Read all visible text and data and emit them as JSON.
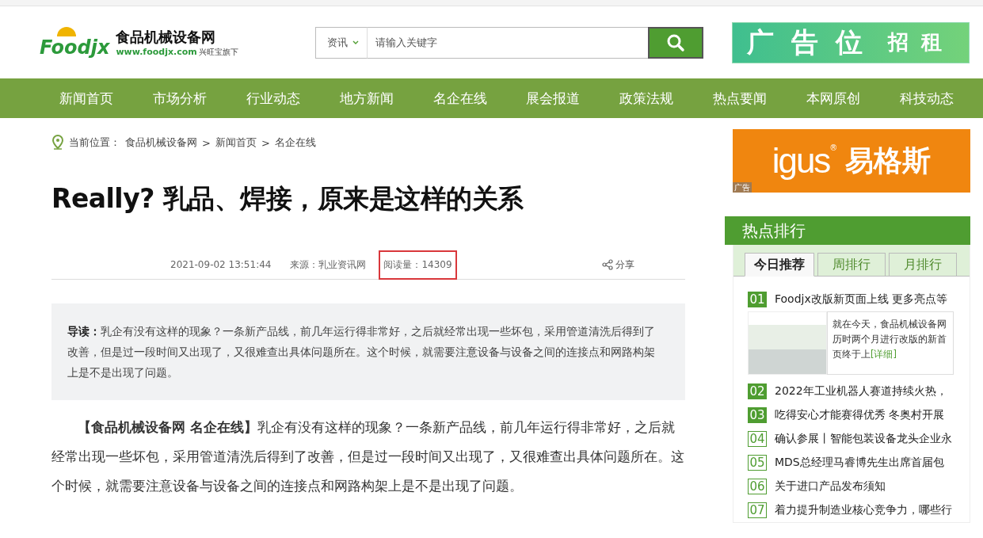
{
  "header": {
    "logo": {
      "mark": "Foodjx",
      "name": "食品机械设备网",
      "url": "www.foodjx.com",
      "owner": "兴旺宝旗下"
    },
    "search": {
      "category": "资讯",
      "placeholder": "请输入关键字"
    },
    "ad": {
      "main": [
        "广",
        "告",
        "位"
      ],
      "sub": [
        "招",
        "租"
      ]
    }
  },
  "nav": [
    {
      "label": "新闻首页"
    },
    {
      "label": "市场分析"
    },
    {
      "label": "行业动态"
    },
    {
      "label": "地方新闻"
    },
    {
      "label": "名企在线"
    },
    {
      "label": "展会报道"
    },
    {
      "label": "政策法规"
    },
    {
      "label": "热点要闻"
    },
    {
      "label": "本网原创"
    },
    {
      "label": "科技动态"
    }
  ],
  "breadcrumb": {
    "prefix": "当前位置：",
    "items": [
      "食品机械设备网",
      "新闻首页",
      "名企在线"
    ],
    "separator": ">"
  },
  "article": {
    "title": "Really? 乳品、焊接，原来是这样的关系",
    "date": "2021-09-02 13:51:44",
    "source": "来源：乳业资讯网",
    "views": "阅读量：14309",
    "views_highlighted": true,
    "share": "分享",
    "intro": "**导读：**乳企有没有这样的现象？一条新产品线，前几年运行得非常好，之后就经常出现一些坏包，采用管道清洗后得到了改善，但是过一段时间又出现了，又很难查出具体问题所在。这个时候，就需要注意设备与设备之间的连接点和网路构架上是不是出现了问题。",
    "body": "**【食品机械设备网 名企在线】**乳企有没有这样的现象？一条新产品线，前几年运行得非常好，之后就经常出现一些坏包，采用管道清洗后得到了改善，但是过一段时间又出现了，又很难查出具体问题所在。这个时候，就需要注意设备与设备之间的连接点和网路构架上是不是出现了问题。"
  },
  "sidebar": {
    "ad": {
      "brand": "igus",
      "mark": "®",
      "name": "易格斯",
      "tag": "广告"
    },
    "ranking": {
      "title": "热点排行",
      "tabs": [
        {
          "label": "今日推荐",
          "selected": true
        },
        {
          "label": "周排行",
          "selected": false
        },
        {
          "label": "月排行",
          "selected": false
        }
      ],
      "items": [
        {
          "rank": "01",
          "kind": "top",
          "title": "Foodjx改版新页面上线 更多亮点等",
          "preview": {
            "text": "就在今天，食品机械设备网历时两个月进行改版的新首页终于上",
            "link": "[详细]"
          }
        },
        {
          "rank": "02",
          "kind": "top",
          "title": "2022年工业机器人赛道持续火热，"
        },
        {
          "rank": "03",
          "kind": "top",
          "title": "吃得安心才能赛得优秀 冬奥村开展"
        },
        {
          "rank": "04",
          "kind": "normal",
          "title": "确认参展丨智能包装设备龙头企业永"
        },
        {
          "rank": "05",
          "kind": "normal",
          "title": "MDS总经理马睿博先生出席首届包"
        },
        {
          "rank": "06",
          "kind": "normal",
          "title": "关于进口产品发布须知"
        },
        {
          "rank": "07",
          "kind": "normal",
          "title": "着力提升制造业核心竞争力，哪些行"
        }
      ]
    }
  }
}
